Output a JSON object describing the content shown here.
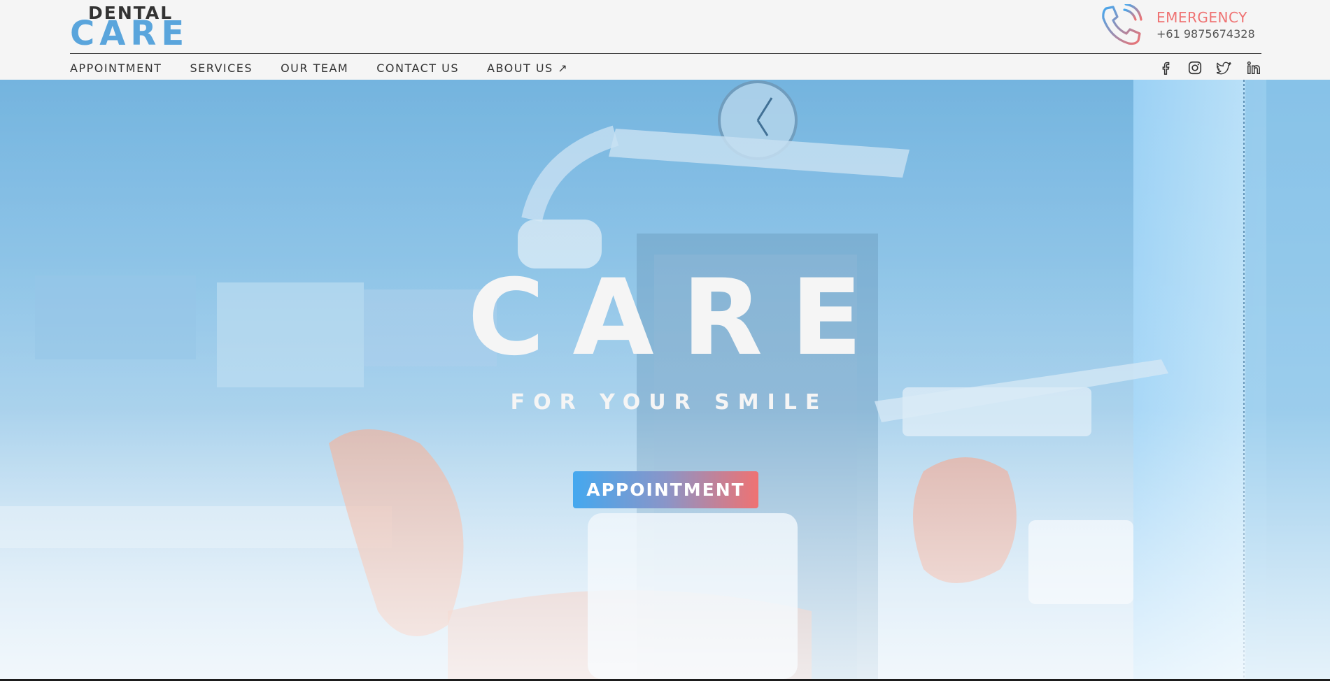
{
  "logo": {
    "top": "DENTAL",
    "bottom": "CARE"
  },
  "emergency": {
    "icon": "phone-icon",
    "title": "EMERGENCY",
    "number": "+61 9875674328"
  },
  "nav": {
    "items": [
      {
        "label": "APPOINTMENT"
      },
      {
        "label": "SERVICES"
      },
      {
        "label": "OUR TEAM"
      },
      {
        "label": "CONTACT US"
      },
      {
        "label": "ABOUT US ↗"
      }
    ]
  },
  "social": [
    "facebook-icon",
    "instagram-icon",
    "twitter-icon",
    "linkedin-icon"
  ],
  "hero": {
    "title": "CARE",
    "subtitle": "FOR YOUR SMILE",
    "button": "APPOINTMENT"
  },
  "colors": {
    "brand_blue": "#5aa5dc",
    "emergency_red": "#ef7272",
    "text_dark": "#333333",
    "header_bg": "#f5f5f5"
  }
}
